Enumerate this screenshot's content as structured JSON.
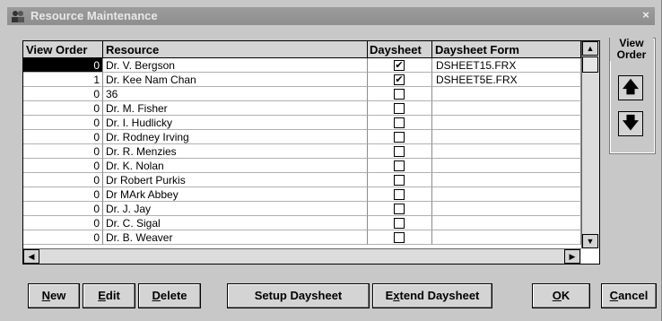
{
  "window": {
    "title": "Resource Maintenance",
    "close_glyph": "×",
    "icon": "users-icon"
  },
  "grid": {
    "columns": [
      "View Order",
      "Resource",
      "Daysheet",
      "Daysheet Form"
    ],
    "rows": [
      {
        "order": "0",
        "resource": "Dr. V. Bergson",
        "daysheet": true,
        "form": "DSHEET15.FRX",
        "selected": true
      },
      {
        "order": "1",
        "resource": "Dr. Kee Nam Chan",
        "daysheet": true,
        "form": "DSHEET5E.FRX"
      },
      {
        "order": "0",
        "resource": "36",
        "daysheet": false,
        "form": ""
      },
      {
        "order": "0",
        "resource": "Dr. M. Fisher",
        "daysheet": false,
        "form": ""
      },
      {
        "order": "0",
        "resource": "Dr. I. Hudlicky",
        "daysheet": false,
        "form": ""
      },
      {
        "order": "0",
        "resource": "Dr. Rodney Irving",
        "daysheet": false,
        "form": ""
      },
      {
        "order": "0",
        "resource": "Dr. R. Menzies",
        "daysheet": false,
        "form": ""
      },
      {
        "order": "0",
        "resource": "Dr. K. Nolan",
        "daysheet": false,
        "form": ""
      },
      {
        "order": "0",
        "resource": "Dr Robert Purkis",
        "daysheet": false,
        "form": ""
      },
      {
        "order": "0",
        "resource": "Dr MArk Abbey",
        "daysheet": false,
        "form": ""
      },
      {
        "order": "0",
        "resource": "Dr. J. Jay",
        "daysheet": false,
        "form": ""
      },
      {
        "order": "0",
        "resource": "Dr. C. Sigal",
        "daysheet": false,
        "form": ""
      },
      {
        "order": "0",
        "resource": "Dr. B. Weaver",
        "daysheet": false,
        "form": ""
      }
    ]
  },
  "view_order": {
    "label_line1": "View",
    "label_line2": "Order",
    "up": "🡅",
    "down": "🡇"
  },
  "buttons": {
    "new": {
      "key": "N",
      "rest": "ew"
    },
    "edit": {
      "key": "E",
      "rest": "dit"
    },
    "delete": {
      "key": "D",
      "rest": "elete"
    },
    "setup_daysheet": "Setup Daysheet",
    "extend_daysheet": {
      "pre": "E",
      "key": "x",
      "rest": "tend Daysheet"
    },
    "ok": {
      "key": "O",
      "rest": "K"
    },
    "cancel": {
      "key": "C",
      "rest": "ancel"
    }
  }
}
